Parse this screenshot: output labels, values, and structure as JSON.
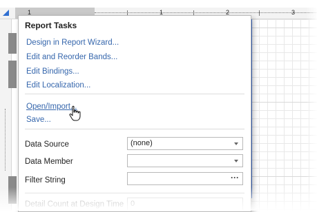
{
  "ruler": {
    "numbers": [
      "1",
      "1",
      "2",
      "3"
    ]
  },
  "panel": {
    "title": "Report Tasks",
    "actions": [
      {
        "label": "Design in Report Wizard..."
      },
      {
        "label": "Edit and Reorder Bands..."
      },
      {
        "label": "Edit Bindings..."
      },
      {
        "label": "Edit Localization..."
      },
      {
        "label": "Open/Import..."
      },
      {
        "label": "Save..."
      }
    ],
    "properties": [
      {
        "label": "Data Source",
        "value": "(none)",
        "editor": "dropdown"
      },
      {
        "label": "Data Member",
        "value": "",
        "editor": "dropdown"
      },
      {
        "label": "Filter String",
        "value": "",
        "editor": "ellipsis",
        "button_text": "···"
      },
      {
        "label": "Detail Count at Design Time",
        "value": "0",
        "editor": "text"
      }
    ]
  },
  "colors": {
    "link": "#3566ac",
    "accent": "#3b6fd4"
  },
  "cursor": {
    "icon": "hand-pointer-icon"
  }
}
